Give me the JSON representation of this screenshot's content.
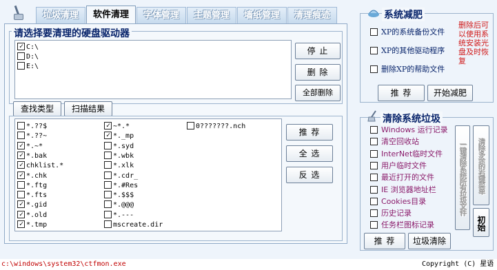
{
  "tabs": [
    {
      "label": "垃圾清理"
    },
    {
      "label": "软件清理"
    },
    {
      "label": "字体管理"
    },
    {
      "label": "主题管理"
    },
    {
      "label": "墙纸管理"
    },
    {
      "label": "清理痕迹"
    }
  ],
  "active_tab": 1,
  "drives_group": {
    "title": "请选择要清理的硬盘驱动器"
  },
  "drives": [
    {
      "label": "C:\\",
      "checked": true
    },
    {
      "label": "D:\\",
      "checked": false
    },
    {
      "label": "E:\\",
      "checked": false
    }
  ],
  "drive_buttons": {
    "stop": "停  止",
    "delete": "删  除",
    "delete_all": "全部删除"
  },
  "subtabs": {
    "find_types": "查找类型",
    "scan_results": "扫描结果"
  },
  "patterns_col1": [
    {
      "label": "*.??$",
      "checked": false
    },
    {
      "label": "*.??~",
      "checked": false
    },
    {
      "label": "*.~*",
      "checked": true
    },
    {
      "label": "*.bak",
      "checked": true
    },
    {
      "label": "chklist.*",
      "checked": true
    },
    {
      "label": "*.chk",
      "checked": true
    },
    {
      "label": "*.ftg",
      "checked": false
    },
    {
      "label": "*.fts",
      "checked": false
    },
    {
      "label": "*.gid",
      "checked": true
    },
    {
      "label": "*.old",
      "checked": true
    },
    {
      "label": "*.tmp",
      "checked": true
    }
  ],
  "patterns_col2": [
    {
      "label": "~*.*",
      "checked": true
    },
    {
      "label": "*._mp",
      "checked": true
    },
    {
      "label": "*.syd",
      "checked": false
    },
    {
      "label": "*.wbk",
      "checked": false
    },
    {
      "label": "*.xlk",
      "checked": false
    },
    {
      "label": "*.cdr_",
      "checked": false
    },
    {
      "label": "*.#Res",
      "checked": false
    },
    {
      "label": "*.$$$",
      "checked": false
    },
    {
      "label": "*.@@@",
      "checked": false
    },
    {
      "label": "*.---",
      "checked": false
    },
    {
      "label": "mscreate.dir",
      "checked": false
    }
  ],
  "patterns_col3": [
    {
      "label": "0???????.nch",
      "checked": false
    }
  ],
  "pattern_buttons": {
    "recommend": "推  荐",
    "select_all": "全  选",
    "invert": "反  选"
  },
  "slim": {
    "title": "系统减肥",
    "items": [
      {
        "label": "XP的系统备份文件",
        "checked": false
      },
      {
        "label": "XP的其他驱动程序",
        "checked": false
      },
      {
        "label": "删除XP的帮助文件",
        "checked": false
      }
    ],
    "note": "删除后可以使用系统安装光盘及时恢复",
    "recommend": "推  荐",
    "start": "开始减肥"
  },
  "junk": {
    "title": "清除系统垃圾",
    "items": [
      {
        "label": "Windows 运行记录",
        "checked": false
      },
      {
        "label": "清空回收站",
        "checked": false
      },
      {
        "label": "InterNet临时文件",
        "checked": false
      },
      {
        "label": "用户临时文件",
        "checked": false
      },
      {
        "label": "最近打开的文件",
        "checked": false
      },
      {
        "label": "IE 浏览器地址栏",
        "checked": false
      },
      {
        "label": "Cookies目录",
        "checked": false
      },
      {
        "label": "历史记录",
        "checked": false
      },
      {
        "label": "任务栏图标记录",
        "checked": false
      }
    ],
    "vbtn1": "一键清除系统所有垃圾文件",
    "vbtn2": "清除多余的右键菜单",
    "vbtn3": "初始",
    "recommend": "推  荐",
    "clean": "垃圾清除"
  },
  "status": {
    "path": "c:\\windows\\system32\\ctfmon.exe",
    "copyright": "Copyright (C) 星语"
  },
  "colors": {
    "accent": "#08246b",
    "note_red": "#d01818",
    "junk_text": "#8a1a6a",
    "status_red": "#c00000"
  }
}
